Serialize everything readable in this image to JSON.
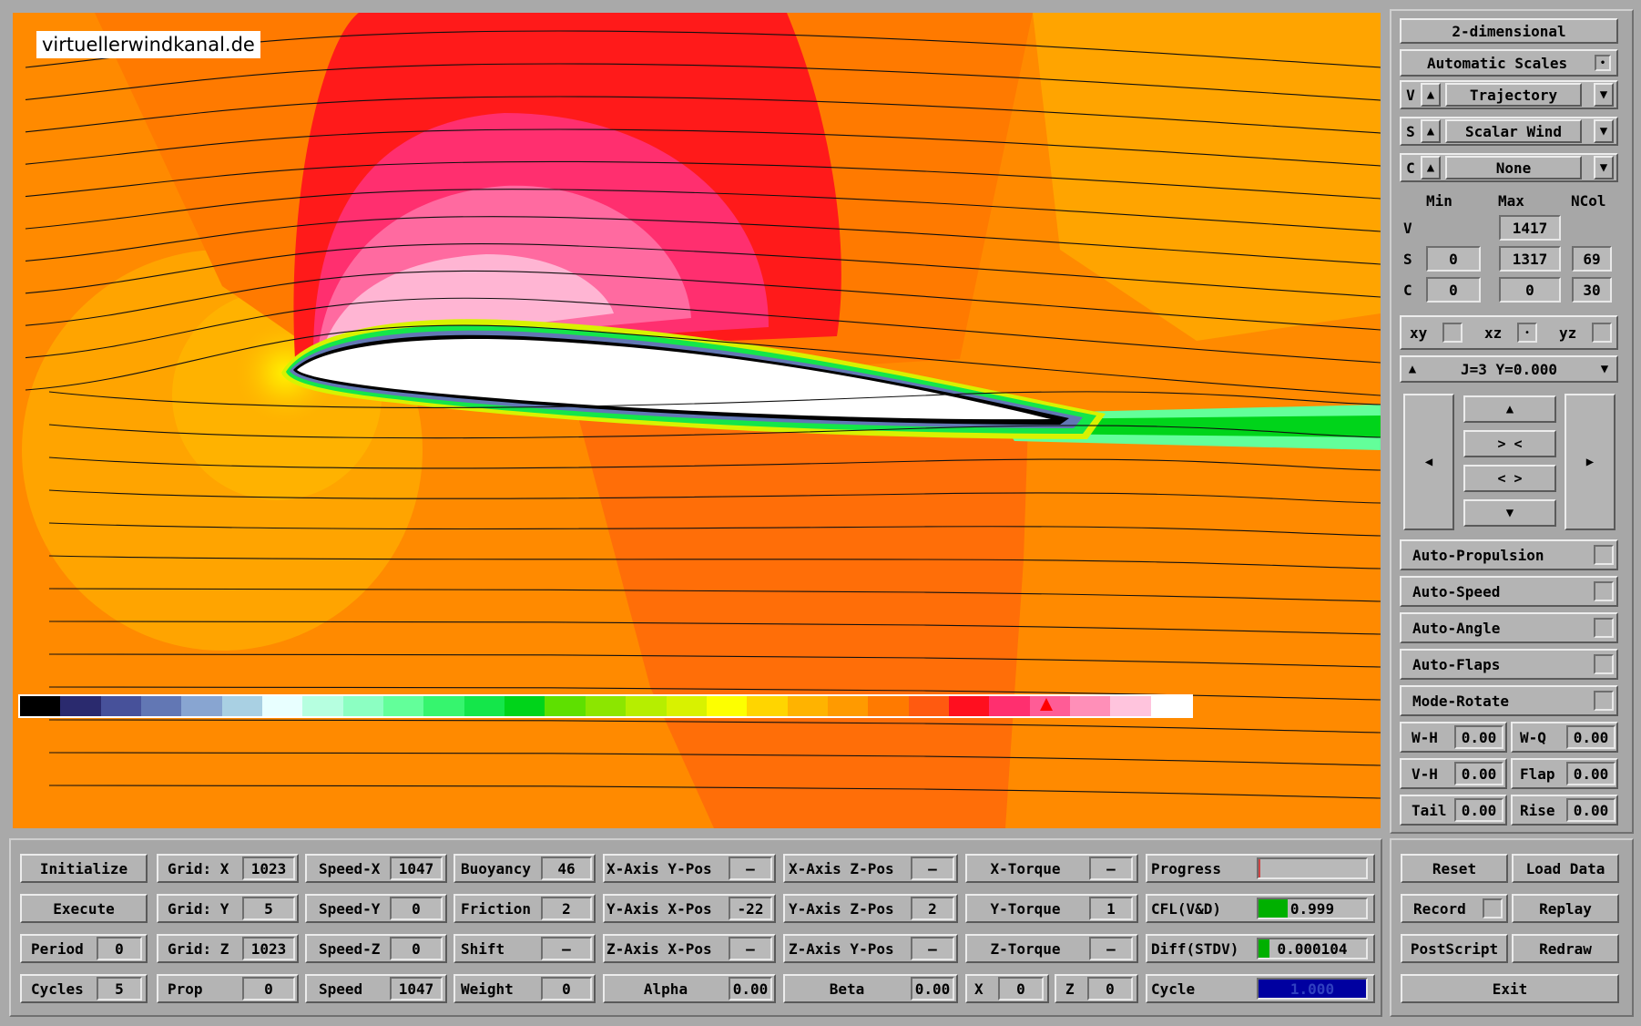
{
  "watermark": "virtuellerwindkanal.de",
  "colors": {
    "flow_base": "#ff8a00",
    "flow_dark": "#ff5a10",
    "flow_light": "#ffa400",
    "suction_red": "#ff1a1a",
    "suction_pink": "#ff7aa8",
    "airfoil": "#ffffff",
    "cycle_bar": "#0000a0",
    "green_bar": "#00b000"
  },
  "colorbar": [
    "#000000",
    "#2a2a6e",
    "#47519a",
    "#6277b4",
    "#88a5d1",
    "#a9d0e3",
    "#e8ffff",
    "#b6ffe0",
    "#8cffc2",
    "#63ff9a",
    "#36f56e",
    "#14e64a",
    "#00d41a",
    "#5ee000",
    "#8ce600",
    "#b6ee00",
    "#d8f200",
    "#fdff00",
    "#ffd500",
    "#ffb300",
    "#ff9a00",
    "#ff7a00",
    "#ff5a10",
    "#ff0f1f",
    "#ff2f6f",
    "#ff5c96",
    "#ff8fb8",
    "#ffc4dd",
    "#ffffff"
  ],
  "right_panel": {
    "view_mode": "2-dimensional",
    "scales": "Automatic Scales",
    "v_row": {
      "letter": "V",
      "value": "Trajectory"
    },
    "s_row": {
      "letter": "S",
      "value": "Scalar Wind"
    },
    "c_row": {
      "letter": "C",
      "value": "None"
    },
    "range_headers": [
      "Min",
      "Max",
      "NCol"
    ],
    "range_rows": [
      {
        "label": "V",
        "min": "",
        "max": "1417",
        "ncol": ""
      },
      {
        "label": "S",
        "min": "0",
        "max": "1317",
        "ncol": "69"
      },
      {
        "label": "C",
        "min": "0",
        "max": "0",
        "ncol": "30"
      }
    ],
    "planes": [
      "xy",
      "xz",
      "yz"
    ],
    "slice": "J=3  Y=0.000",
    "nav": {
      "up": "▲",
      "zoom_in": "> <",
      "zoom_out": "< >",
      "down": "▼",
      "left": "◀",
      "right": "▶"
    },
    "toggles": [
      "Auto-Propulsion",
      "Auto-Speed",
      "Auto-Angle",
      "Auto-Flaps",
      "Mode-Rotate"
    ],
    "params": [
      {
        "l1": "W-H",
        "v1": "0.00",
        "l2": "W-Q",
        "v2": "0.00"
      },
      {
        "l1": "V-H",
        "v1": "0.00",
        "l2": "Flap",
        "v2": "0.00"
      },
      {
        "l1": "Tail",
        "v1": "0.00",
        "l2": "Rise",
        "v2": "0.00"
      }
    ]
  },
  "bottom": {
    "col1": [
      "Initialize",
      "Execute",
      {
        "label": "Period",
        "value": "0"
      },
      {
        "label": "Cycles",
        "value": "5"
      }
    ],
    "col2": [
      {
        "label": "Grid: X",
        "value": "1023"
      },
      {
        "label": "Grid: Y",
        "value": "5"
      },
      {
        "label": "Grid: Z",
        "value": "1023"
      },
      {
        "label": "Prop",
        "value": "0"
      }
    ],
    "col3": [
      {
        "label": "Speed-X",
        "value": "1047"
      },
      {
        "label": "Speed-Y",
        "value": "0"
      },
      {
        "label": "Speed-Z",
        "value": "0"
      },
      {
        "label": "Speed",
        "value": "1047"
      }
    ],
    "col4": [
      {
        "label": "Buoyancy",
        "value": "46"
      },
      {
        "label": "Friction",
        "value": "2"
      },
      {
        "label": "Shift",
        "value": "—"
      },
      {
        "label": "Weight",
        "value": "0"
      }
    ],
    "col5": [
      {
        "label": "X-Axis Y-Pos",
        "value": "—"
      },
      {
        "label": "Y-Axis X-Pos",
        "value": "-22"
      },
      {
        "label": "Z-Axis X-Pos",
        "value": "—"
      },
      {
        "label": "Alpha",
        "value": "0.00"
      }
    ],
    "col6": [
      {
        "label": "X-Axis Z-Pos",
        "value": "—"
      },
      {
        "label": "Y-Axis Z-Pos",
        "value": "2"
      },
      {
        "label": "Z-Axis Y-Pos",
        "value": "—"
      },
      {
        "label": "Beta",
        "value": "0.00"
      }
    ],
    "col7": [
      {
        "label": "X-Torque",
        "value": "—"
      },
      {
        "label": "Y-Torque",
        "value": "1"
      },
      {
        "label": "Z-Torque",
        "value": "—"
      },
      {
        "label": "X",
        "value": "0",
        "label2": "Z",
        "value2": "0"
      }
    ],
    "col8": [
      {
        "label": "Progress",
        "value": "",
        "progress": 0.01
      },
      {
        "label": "CFL(V&D)",
        "value": "0.999",
        "progress": 0.27
      },
      {
        "label": "Diff(STDV)",
        "value": "0.000104",
        "progress": 0.1
      },
      {
        "label": "Cycle",
        "value": "1.000",
        "progress": 1.0
      }
    ],
    "actions": [
      {
        "a": "Reset",
        "b": "Load Data"
      },
      {
        "a": "Record",
        "b": "Replay"
      },
      {
        "a": "PostScript",
        "b": "Redraw"
      },
      {
        "a": "Exit"
      }
    ]
  }
}
